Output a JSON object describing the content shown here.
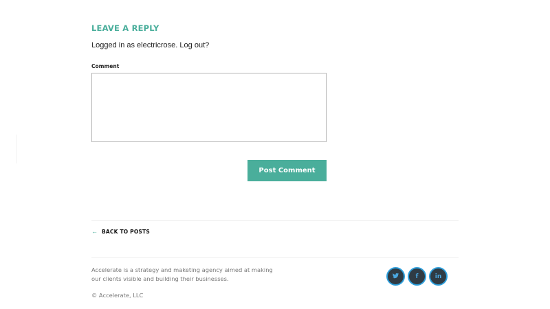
{
  "reply": {
    "heading": "LEAVE A REPLY",
    "logged_prefix": "Logged in as electricrose.",
    "logout_label": "Log out?",
    "comment_label": "Comment",
    "comment_value": "",
    "submit_label": "Post Comment"
  },
  "nav": {
    "back_arrow": "←",
    "back_label": "BACK TO POSTS"
  },
  "footer": {
    "about": "Accelerate is a strategy and maketing agency aimed at making our clients visible and building their businesses.",
    "copyright": "© Accelerate, LLC",
    "social": [
      {
        "name": "twitter",
        "icon": "twitter-bird-icon"
      },
      {
        "name": "facebook",
        "icon": "facebook-f-icon",
        "glyph": "f"
      },
      {
        "name": "linkedin",
        "icon": "linkedin-in-icon",
        "glyph": "in"
      }
    ]
  },
  "colors": {
    "accent": "#4aae9b",
    "social_bg": "#2f3b44",
    "social_ring": "#2e9fdc",
    "muted_text": "#777777"
  }
}
